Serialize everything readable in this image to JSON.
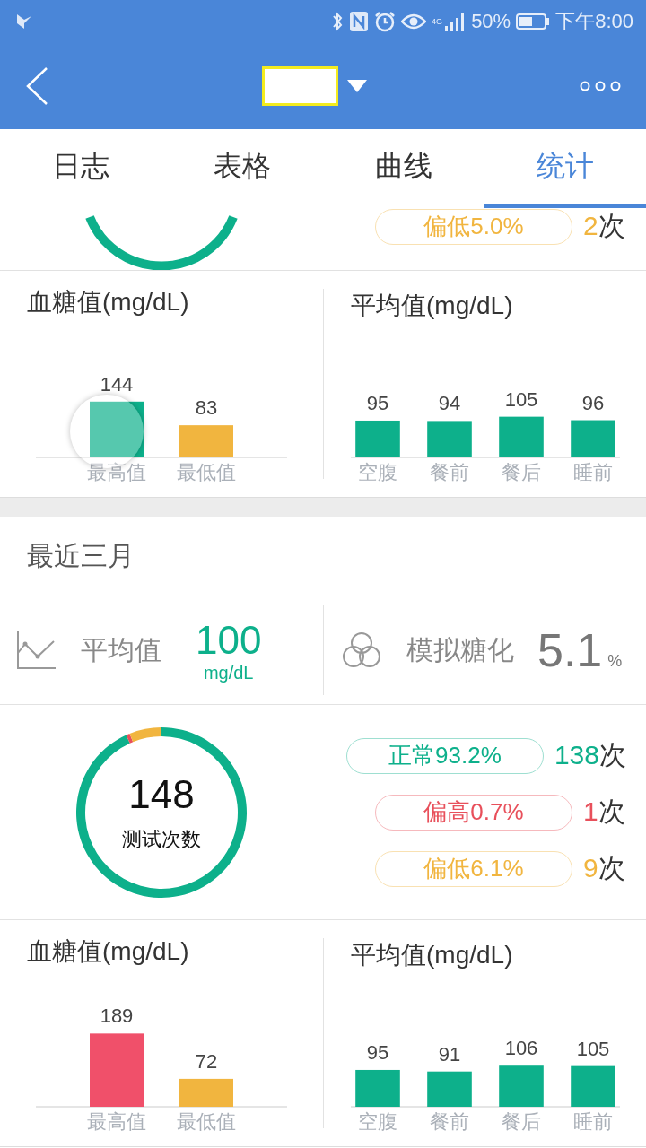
{
  "status_bar": {
    "network": "4G",
    "battery": "50%",
    "time": "下午8:00"
  },
  "tabs": [
    {
      "label": "日志",
      "selected": false
    },
    {
      "label": "表格",
      "selected": false
    },
    {
      "label": "曲线",
      "selected": false
    },
    {
      "label": "统计",
      "selected": true
    }
  ],
  "previous_period": {
    "legend": [
      {
        "label": "偏低5.0%",
        "count": "2",
        "unit": "次",
        "color": "#f1b53f"
      }
    ],
    "charts": [
      {
        "title": "血糖值(mg/dL)",
        "bars": [
          {
            "color": "#0db08b"
          },
          {
            "color": "#f1b53f"
          }
        ],
        "chart_data": {
          "type": "bar",
          "categories": [
            "最高值",
            "最低值"
          ],
          "values": [
            144,
            83
          ],
          "data_labels": true
        }
      },
      {
        "title": "平均值(mg/dL)",
        "bars": [
          {
            "color": "#0db08b"
          },
          {
            "color": "#0db08b"
          },
          {
            "color": "#0db08b"
          },
          {
            "color": "#0db08b"
          }
        ],
        "chart_data": {
          "type": "bar",
          "categories": [
            "空腹",
            "餐前",
            "餐后",
            "睡前"
          ],
          "values": [
            95,
            94,
            105,
            96
          ],
          "data_labels": true
        }
      }
    ]
  },
  "recent_three_months": {
    "title": "最近三月",
    "summary": [
      {
        "kind": "average",
        "label": "平均值",
        "value": "100",
        "unit": "mg/dL"
      },
      {
        "kind": "hba1c",
        "label": "模拟糖化",
        "value": "5.1",
        "unit": "%"
      }
    ],
    "test_count": {
      "value": "148",
      "label": "测试次数",
      "chart_data": {
        "type": "donut",
        "values": [
          93.2,
          0.7,
          6.1
        ]
      }
    },
    "legend": [
      {
        "label": "正常93.2%",
        "count": "138",
        "unit": "次",
        "color": "#0db08b"
      },
      {
        "label": "偏高0.7%",
        "count": "1",
        "unit": "次",
        "color": "#e8505b"
      },
      {
        "label": "偏低6.1%",
        "count": "9",
        "unit": "次",
        "color": "#f1b53f"
      }
    ],
    "charts": [
      {
        "title": "血糖值(mg/dL)",
        "bars": [
          {
            "color": "#f0506a"
          },
          {
            "color": "#f1b53f"
          }
        ],
        "chart_data": {
          "type": "bar",
          "categories": [
            "最高值",
            "最低值"
          ],
          "values": [
            189,
            72
          ],
          "data_labels": true
        }
      },
      {
        "title": "平均值(mg/dL)",
        "bars": [
          {
            "color": "#0db08b"
          },
          {
            "color": "#0db08b"
          },
          {
            "color": "#0db08b"
          },
          {
            "color": "#0db08b"
          }
        ],
        "chart_data": {
          "type": "bar",
          "categories": [
            "空腹",
            "餐前",
            "餐后",
            "睡前"
          ],
          "values": [
            95,
            91,
            106,
            105
          ],
          "data_labels": true
        }
      }
    ]
  }
}
